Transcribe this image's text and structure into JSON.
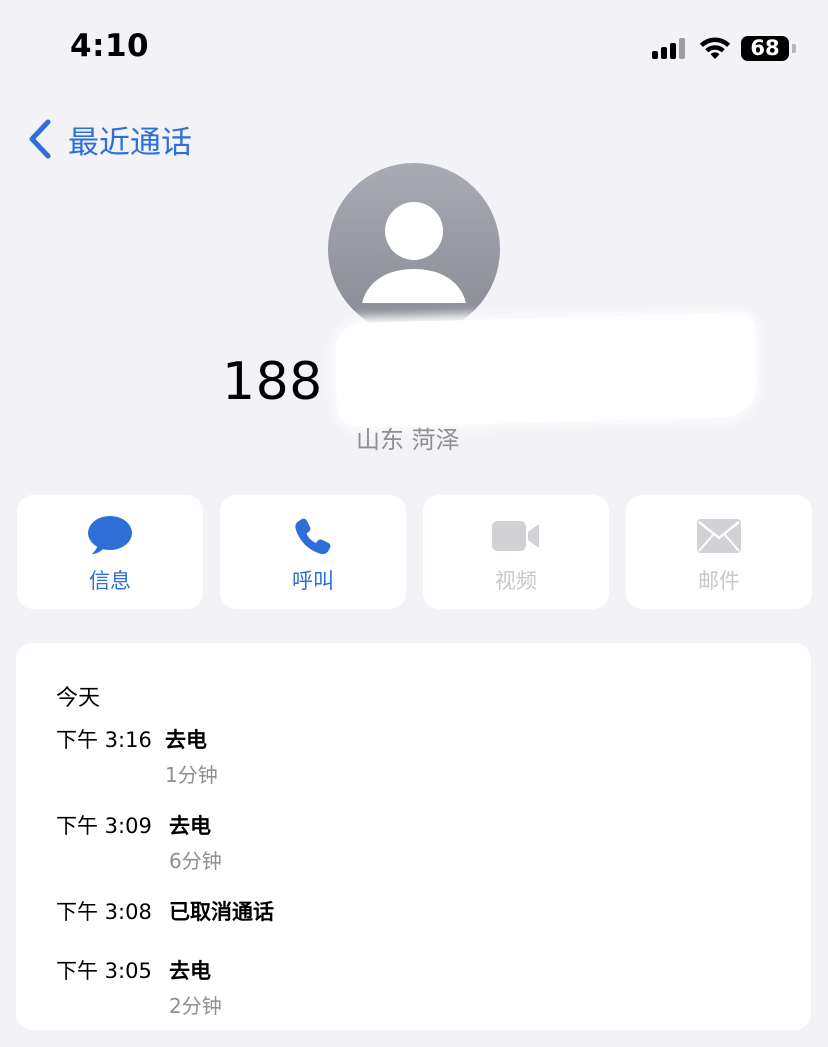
{
  "status_bar": {
    "time": "4:10",
    "battery": "68"
  },
  "nav": {
    "back_label": "最近通话"
  },
  "contact": {
    "number_visible": "188 8",
    "location": "山东 菏泽"
  },
  "actions": {
    "message": "信息",
    "call": "呼叫",
    "video": "视频",
    "mail": "邮件"
  },
  "history": {
    "title": "今天",
    "entries": [
      {
        "time": "下午 3:16",
        "type": "去电",
        "duration": "1分钟"
      },
      {
        "time": "下午 3:09",
        "type": "去电",
        "duration": "6分钟"
      },
      {
        "time": "下午 3:08",
        "type": "已取消通话",
        "duration": ""
      },
      {
        "time": "下午 3:05",
        "type": "去电",
        "duration": "2分钟"
      }
    ]
  },
  "colors": {
    "accent": "#2f6fd8",
    "background": "#f2f2f7",
    "disabled": "#c7c7cc",
    "secondary_text": "#8e8e93"
  }
}
